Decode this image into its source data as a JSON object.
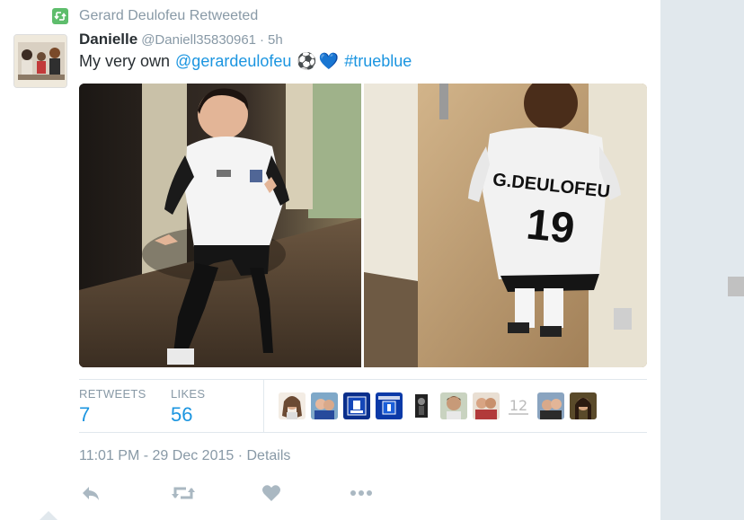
{
  "retweet_context": {
    "text": "Gerard Deulofeu Retweeted"
  },
  "tweet": {
    "fullname": "Danielle",
    "username": "@Daniell35830961",
    "separator": "·",
    "time_ago": "5h",
    "text_prefix": "My very own",
    "mention": "@gerardeulofeu",
    "hashtag": "#trueblue",
    "emoji_1": "⚽",
    "emoji_2": "💙"
  },
  "media": {
    "left_photo": {
      "jersey_name": "",
      "jersey_number": ""
    },
    "right_photo": {
      "jersey_name": "G.DEULOFEU",
      "jersey_number": "19"
    }
  },
  "stats": {
    "retweets_label": "RETWEETS",
    "retweets_value": "7",
    "likes_label": "LIKES",
    "likes_value": "56"
  },
  "liked_by": [
    "avatar-1",
    "avatar-2",
    "avatar-3",
    "avatar-4",
    "avatar-5",
    "avatar-6",
    "avatar-7",
    "avatar-8",
    "avatar-9"
  ],
  "timestamp": {
    "time": "11:01 PM",
    "separator": "-",
    "date": "29 Dec 2015",
    "dot": "·",
    "details": "Details"
  },
  "actions": [
    "reply-icon",
    "retweet-icon",
    "like-icon",
    "more-icon"
  ],
  "colors": {
    "link": "#1b95e0",
    "muted": "#8899a6",
    "retweet_green": "#5ebd6c",
    "text": "#292f33",
    "action_icon": "#aab8c2"
  }
}
